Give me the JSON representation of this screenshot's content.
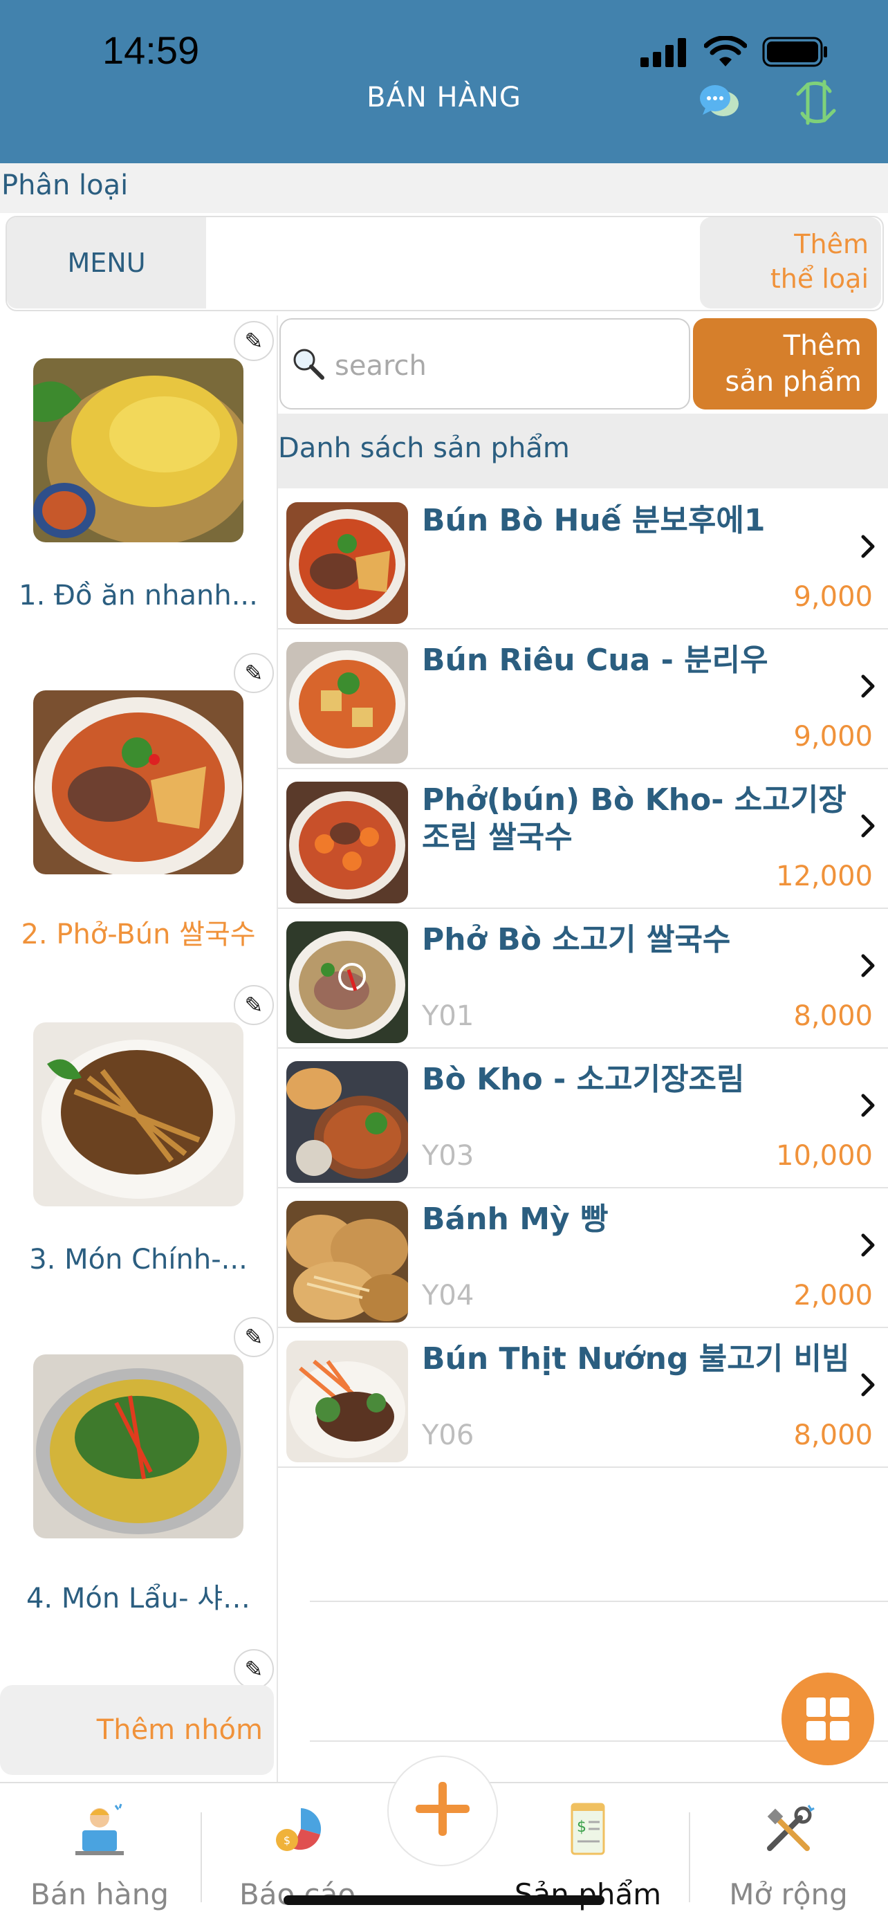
{
  "status_bar": {
    "time": "14:59"
  },
  "header": {
    "title": "BÁN HÀNG"
  },
  "category": {
    "label": "Phân loại",
    "tab_menu": "MENU",
    "add_category_line1": "Thêm",
    "add_category_line2": "thể loại"
  },
  "groups": {
    "items": [
      {
        "label": "1. Đồ ăn nhanh..."
      },
      {
        "label": "2. Phở-Bún 쌀국수"
      },
      {
        "label": "3. Món Chính-..."
      },
      {
        "label": "4. Món Lẩu- 샤…"
      }
    ],
    "add_group": "Thêm nhóm"
  },
  "search": {
    "placeholder": "search"
  },
  "add_product": {
    "line1": "Thêm",
    "line2": "sản phẩm"
  },
  "product_list": {
    "header": "Danh sách sản phẩm",
    "items": [
      {
        "name": "Bún Bò Huế 분보후에1",
        "code": "",
        "price": "9,000"
      },
      {
        "name": "Bún Riêu Cua - 분리우",
        "code": "",
        "price": "9,000"
      },
      {
        "name": "Phở(bún) Bò Kho- 소고기장조림 쌀국수",
        "code": "",
        "price": "12,000"
      },
      {
        "name": "Phở Bò 소고기 쌀국수",
        "code": "Y01",
        "price": "8,000"
      },
      {
        "name": "Bò Kho - 소고기장조림",
        "code": "Y03",
        "price": "10,000"
      },
      {
        "name": "Bánh Mỳ 빵",
        "code": "Y04",
        "price": "2,000"
      },
      {
        "name": "Bún Thịt Nướng 불고기 비빔",
        "code": "Y06",
        "price": "8,000"
      }
    ]
  },
  "tabbar": {
    "items": [
      {
        "label": "Bán hàng"
      },
      {
        "label": "Báo cáo"
      },
      {
        "label": "Sản phẩm"
      },
      {
        "label": "Mở rộng"
      }
    ]
  },
  "colors": {
    "header_bg": "#4282ad",
    "accent": "#f0923a",
    "text_primary": "#2b5e80"
  }
}
